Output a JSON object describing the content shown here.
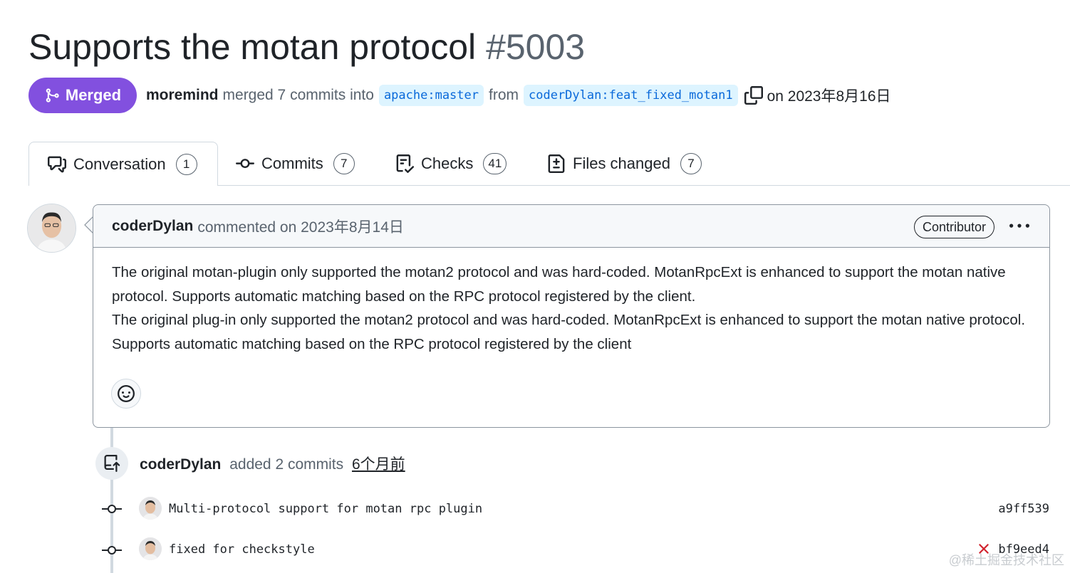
{
  "pr": {
    "title": "Supports the motan protocol",
    "number": "#5003",
    "state": "Merged",
    "merger": "moremind",
    "merge_text": "merged 7 commits into",
    "base_branch": "apache:master",
    "from_text": "from",
    "head_branch": "coderDylan:feat_fixed_motan1",
    "date_text": "on 2023年8月16日",
    "accent": "#8250df"
  },
  "tabs": [
    {
      "label": "Conversation",
      "count": "1",
      "icon": "comment-discussion-icon"
    },
    {
      "label": "Commits",
      "count": "7",
      "icon": "git-commit-icon"
    },
    {
      "label": "Checks",
      "count": "41",
      "icon": "checklist-icon"
    },
    {
      "label": "Files changed",
      "count": "7",
      "icon": "file-diff-icon"
    }
  ],
  "comment": {
    "author": "coderDylan",
    "action": "commented on 2023年8月14日",
    "badge": "Contributor",
    "body": [
      "The original motan-plugin only supported the motan2 protocol and was hard-coded. MotanRpcExt is enhanced to support the motan native protocol. Supports automatic matching based on the RPC protocol registered by the client.",
      "The original plug-in only supported the motan2 protocol and was hard-coded. MotanRpcExt is enhanced to support the motan native protocol. Supports automatic matching based on the RPC protocol registered by the client"
    ]
  },
  "timeline": {
    "push": {
      "author": "coderDylan",
      "text": "added 2 commits",
      "time": "6个月前"
    },
    "commits": [
      {
        "message": "Multi-protocol support for motan rpc plugin",
        "sha": "a9ff539",
        "status": "none"
      },
      {
        "message": "fixed for checkstyle",
        "sha": "bf9eed4",
        "status": "failed"
      }
    ]
  },
  "watermark": "@稀土掘金技术社区"
}
